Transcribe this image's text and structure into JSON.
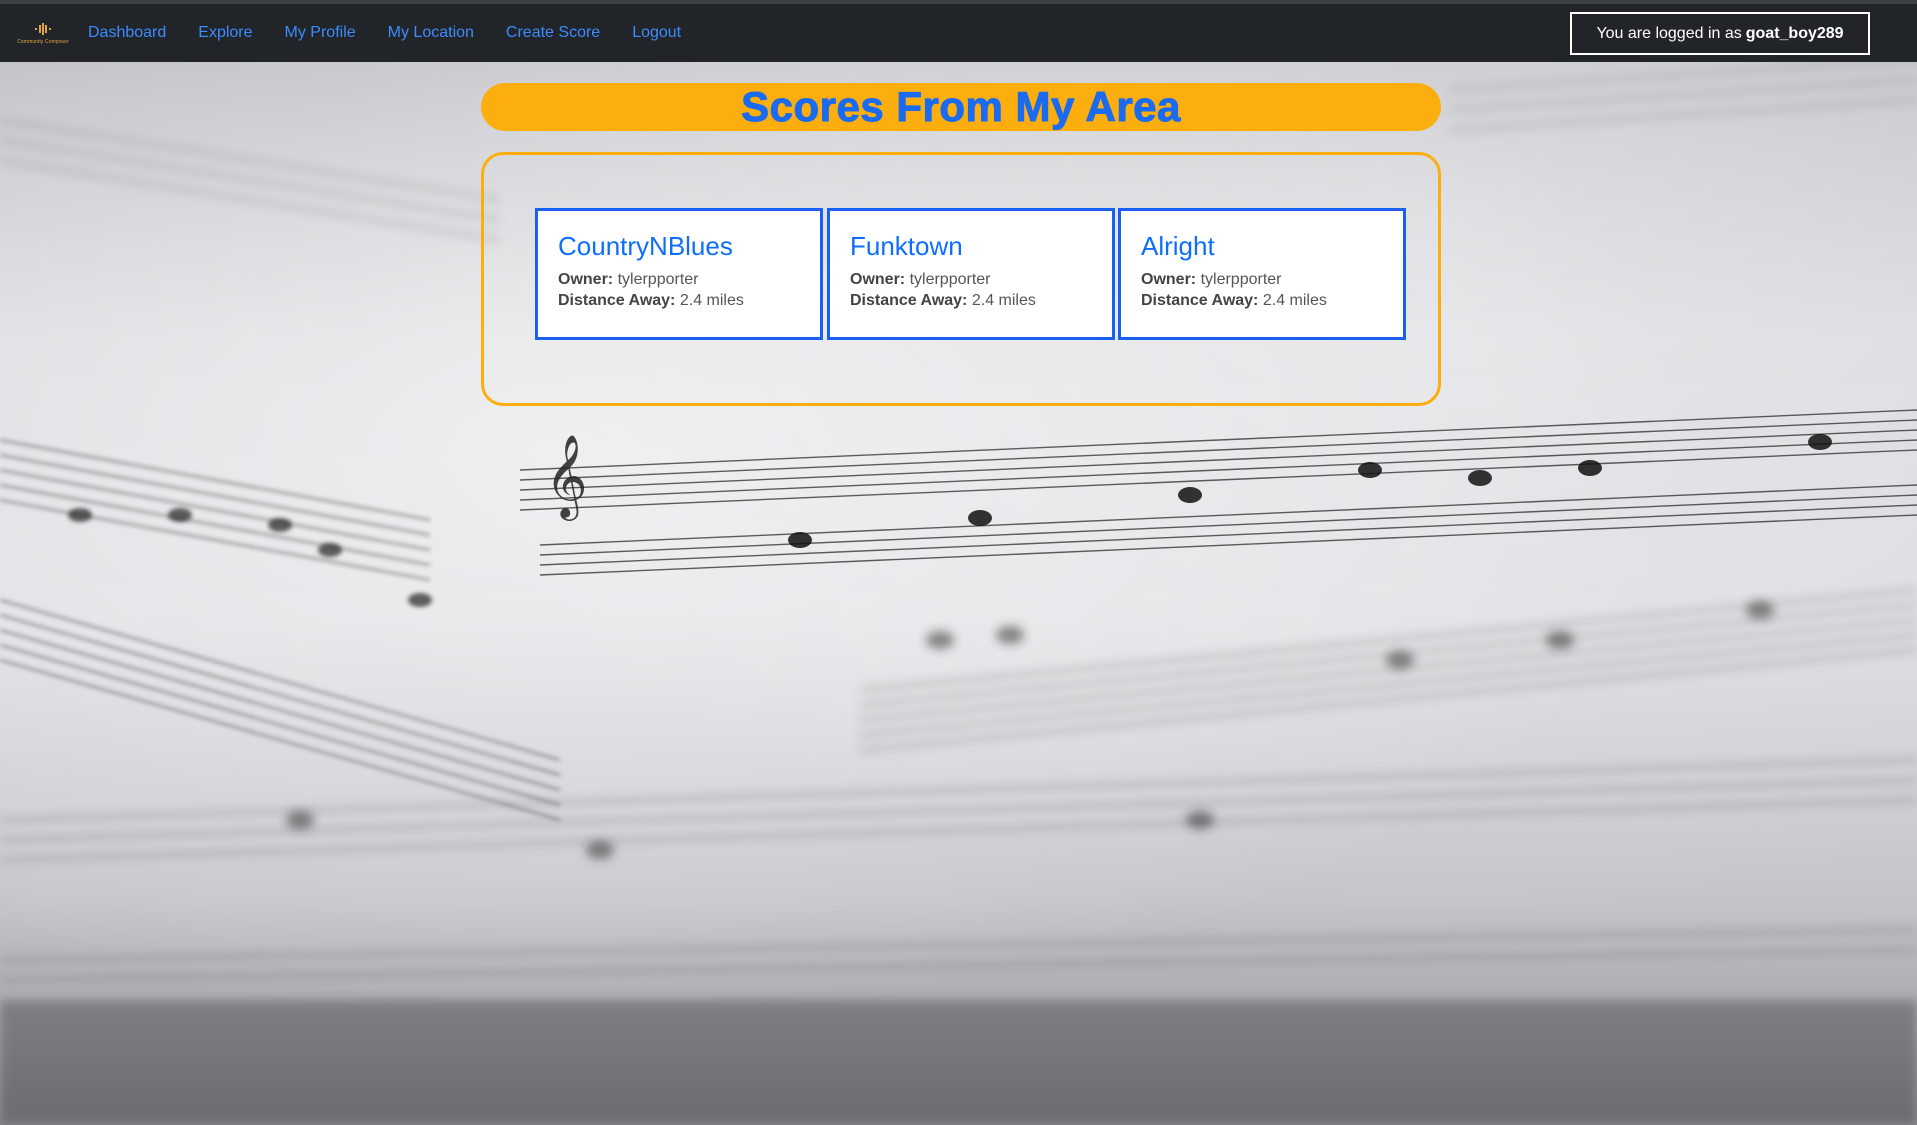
{
  "brand": {
    "logo_text": "Community Composer",
    "accent_color": "#e0a640"
  },
  "nav": {
    "links": [
      "Dashboard",
      "Explore",
      "My Profile",
      "My Location",
      "Create Score",
      "Logout"
    ],
    "link_color": "#3d8bfd",
    "background": "#212529"
  },
  "login": {
    "prefix": "You are logged in as",
    "username": "goat_boy289"
  },
  "page": {
    "title": "Scores From My Area",
    "title_color": "#1a6bf0",
    "banner_color": "#fdae0f"
  },
  "scores": [
    {
      "title": "CountryNBlues",
      "owner_label": "Owner:",
      "owner": "tylerpporter",
      "distance_label": "Distance Away:",
      "distance": "2.4 miles"
    },
    {
      "title": "Funktown",
      "owner_label": "Owner:",
      "owner": "tylerpporter",
      "distance_label": "Distance Away:",
      "distance": "2.4 miles"
    },
    {
      "title": "Alright",
      "owner_label": "Owner:",
      "owner": "tylerpporter",
      "distance_label": "Distance Away:",
      "distance": "2.4 miles"
    }
  ],
  "background": {
    "image": "sheet-music-photo"
  }
}
